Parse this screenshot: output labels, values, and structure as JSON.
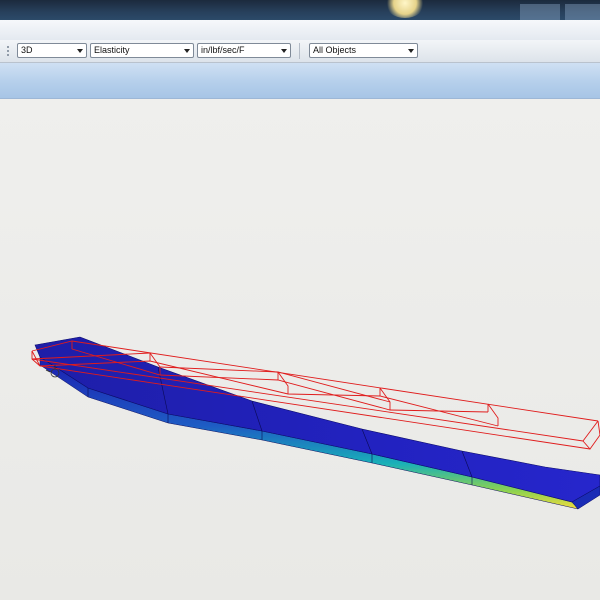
{
  "toolbar": {
    "view_mode": {
      "value": "3D",
      "icon": "chevron-down-icon"
    },
    "analysis_type": {
      "value": "Elasticity",
      "icon": "chevron-down-icon"
    },
    "units": {
      "value": "in/lbf/sec/F",
      "icon": "chevron-down-icon"
    },
    "object_filter": {
      "value": "All Objects",
      "icon": "chevron-down-icon"
    }
  },
  "viewport": {
    "model": "beam-mesh",
    "result_colormap": [
      "#1a1aa8",
      "#2020c8",
      "#1e64c8",
      "#19b4b4",
      "#8cd250",
      "#f0dc3c"
    ],
    "undeformed_outline_color": "#e21e1e",
    "triad_icon": "coordinate-triad-icon"
  }
}
